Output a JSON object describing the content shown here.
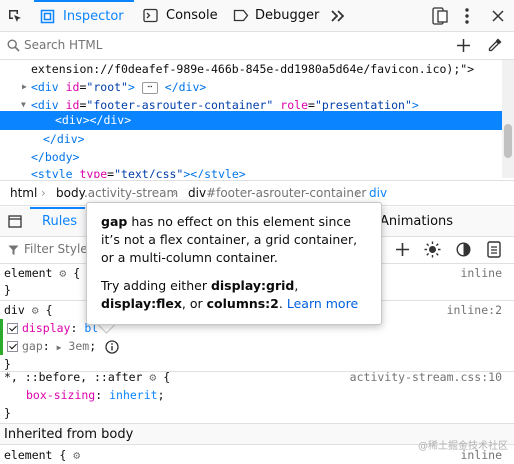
{
  "toolbar": {
    "tabs": [
      {
        "label": "Inspector"
      },
      {
        "label": "Console"
      },
      {
        "label": "Debugger"
      }
    ]
  },
  "search": {
    "placeholder": "Search HTML"
  },
  "markup": {
    "lines": [
      "extension://f0deafef-989e-466b-845e-dd1980a5d64e/favicon.ico);\">",
      "<div id=\"root\">",
      "</div>",
      "<div id=\"footer-asrouter-container\" role=\"presentation\">",
      "<div></div>",
      "</div>",
      "</body>",
      "<style type=\"text/css\"></style>"
    ],
    "root_tag_open": "<div ",
    "root_attr": "id",
    "root_val": "\"root\"",
    "root_close": ">",
    "root_end": "</div>",
    "footer_open": "<div ",
    "footer_attr1": "id",
    "footer_val1": "\"footer-asrouter-container\"",
    "footer_attr2": "role",
    "footer_val2": "\"presentation\"",
    "footer_close": ">",
    "selected": "<div></div>",
    "div_close": "</div>",
    "body_close": "</body>",
    "style_open": "<style ",
    "style_attr": "type",
    "style_val": "\"text/css\"",
    "style_close": "></style>",
    "ext_line": "extension://f0deafef-989e-466b-845e-dd1980a5d64e/favicon.ico);\">"
  },
  "breadcrumb": [
    {
      "tag": "html",
      "extra": ""
    },
    {
      "tag": "body",
      "extra": ".activity-stream"
    },
    {
      "tag": "div",
      "extra": "#footer-asrouter-container"
    },
    {
      "tag": "div",
      "extra": ""
    }
  ],
  "rules_panel": {
    "tabs": {
      "rules": "Rules",
      "animations": "Animations"
    },
    "filter_placeholder": "Filter Styles",
    "rules": [
      {
        "selector": "element",
        "source": "inline",
        "open": "{",
        "close": "}"
      },
      {
        "selector": "div",
        "source": "inline:2",
        "open": "{",
        "close": "}",
        "props": [
          {
            "name": "display",
            "value": "block",
            "visible_value": "bl"
          },
          {
            "name": "gap",
            "value": "3em"
          }
        ]
      },
      {
        "selector": "*, ::before, ::after",
        "source": "activity-stream.css:10",
        "open": "{",
        "close": "}",
        "props": [
          {
            "name": "box-sizing",
            "value": "inherit"
          }
        ]
      },
      {
        "selector": "element",
        "source": "inline",
        "open": "{"
      }
    ],
    "inherited_header": "Inherited from body"
  },
  "tooltip": {
    "p1_prop": "gap",
    "p1_text": " has no effect on this element since it’s not a flex container, a grid container, or a multi-column container.",
    "p2_prefix": "Try adding either ",
    "p2_opt1": "display:grid",
    "p2_sep1": ", ",
    "p2_opt2": "display:flex",
    "p2_sep2": ", or ",
    "p2_opt3": "columns:2",
    "p2_end": ". ",
    "link": "Learn more"
  },
  "watermark": "@稀土掘金技术社区",
  "colors": {
    "accent": "#0a84ff",
    "tag": "#0074e8",
    "attr": "#dd00a9",
    "changed": "#2bab2b"
  }
}
